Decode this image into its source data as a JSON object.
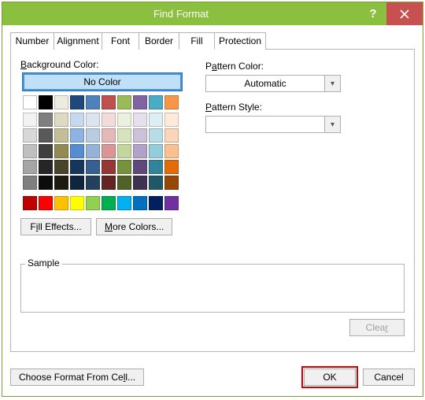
{
  "window": {
    "title": "Find Format"
  },
  "tabs": {
    "number": "Number",
    "alignment": "Alignment",
    "font": "Font",
    "border": "Border",
    "fill": "Fill",
    "protection": "Protection"
  },
  "fill": {
    "bg_label": "Background Color:",
    "no_color": "No Color",
    "pattern_color_label": "Pattern Color:",
    "pattern_color_value": "Automatic",
    "pattern_style_label": "Pattern Style:",
    "pattern_style_value": "",
    "fill_effects": "Fill Effects...",
    "more_colors": "More Colors..."
  },
  "sample": {
    "label": "Sample"
  },
  "buttons": {
    "clear": "Clear",
    "choose": "Choose Format From Cell...",
    "ok": "OK",
    "cancel": "Cancel"
  },
  "palette": {
    "row0": [
      "#ffffff",
      "#000000",
      "#eeece1",
      "#1f497d",
      "#4f81bd",
      "#c0504d",
      "#9bbb59",
      "#8064a2",
      "#4bacc6",
      "#f79646"
    ],
    "theme": [
      [
        "#f2f2f2",
        "#7f7f7f",
        "#ddd9c3",
        "#c6d9f0",
        "#dbe5f1",
        "#f2dcdb",
        "#ebf1dd",
        "#e5e0ec",
        "#dbeef3",
        "#fdeada"
      ],
      [
        "#d8d8d8",
        "#595959",
        "#c4bd97",
        "#8db3e2",
        "#b8cce4",
        "#e5b9b7",
        "#d7e3bc",
        "#ccc1d9",
        "#b7dde8",
        "#fbd5b5"
      ],
      [
        "#bfbfbf",
        "#3f3f3f",
        "#938953",
        "#548dd4",
        "#95b3d7",
        "#d99694",
        "#c3d69b",
        "#b2a2c7",
        "#92cddc",
        "#fac08f"
      ],
      [
        "#a5a5a5",
        "#262626",
        "#494429",
        "#17365d",
        "#366092",
        "#953734",
        "#76923c",
        "#5f497a",
        "#31859b",
        "#e36c09"
      ],
      [
        "#7f7f7f",
        "#0c0c0c",
        "#1d1b10",
        "#0f243e",
        "#244061",
        "#632423",
        "#4f6228",
        "#3f3151",
        "#205867",
        "#974806"
      ]
    ],
    "standard": [
      "#c00000",
      "#ff0000",
      "#ffc000",
      "#ffff00",
      "#92d050",
      "#00b050",
      "#00b0f0",
      "#0070c0",
      "#002060",
      "#7030a0"
    ]
  }
}
